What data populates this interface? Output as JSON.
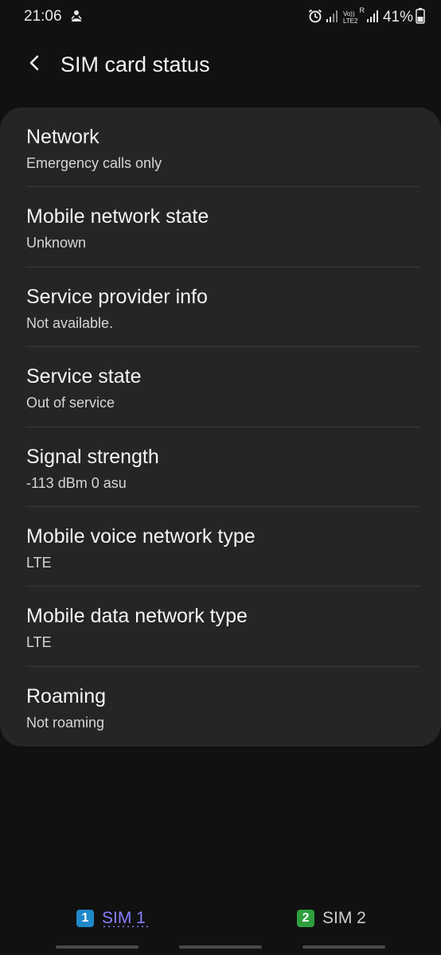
{
  "status_bar": {
    "time": "21:06",
    "volte_line1": "Vo))",
    "volte_line2": "LTE2",
    "roaming_indicator": "R",
    "battery": "41%"
  },
  "header": {
    "title": "SIM card status"
  },
  "items": [
    {
      "title": "Network",
      "value": "Emergency calls only"
    },
    {
      "title": "Mobile network state",
      "value": "Unknown"
    },
    {
      "title": "Service provider info",
      "value": "Not available."
    },
    {
      "title": "Service state",
      "value": "Out of service"
    },
    {
      "title": "Signal strength",
      "value": "-113 dBm 0 asu"
    },
    {
      "title": "Mobile voice network type",
      "value": "LTE"
    },
    {
      "title": "Mobile data network type",
      "value": "LTE"
    },
    {
      "title": "Roaming",
      "value": "Not roaming"
    }
  ],
  "tabs": [
    {
      "badge": "1",
      "label": "SIM 1",
      "selected": true,
      "badge_color": "#1e88c8",
      "label_color": "#8a7fff"
    },
    {
      "badge": "2",
      "label": "SIM 2",
      "selected": false,
      "badge_color": "#2e9e3e",
      "label_color": "#cfcfcf"
    }
  ],
  "icons": {
    "back": "chevron-left-icon",
    "alarm": "alarm-icon",
    "signal": "signal-icon",
    "battery": "battery-icon",
    "notification": "app-notification-icon"
  }
}
